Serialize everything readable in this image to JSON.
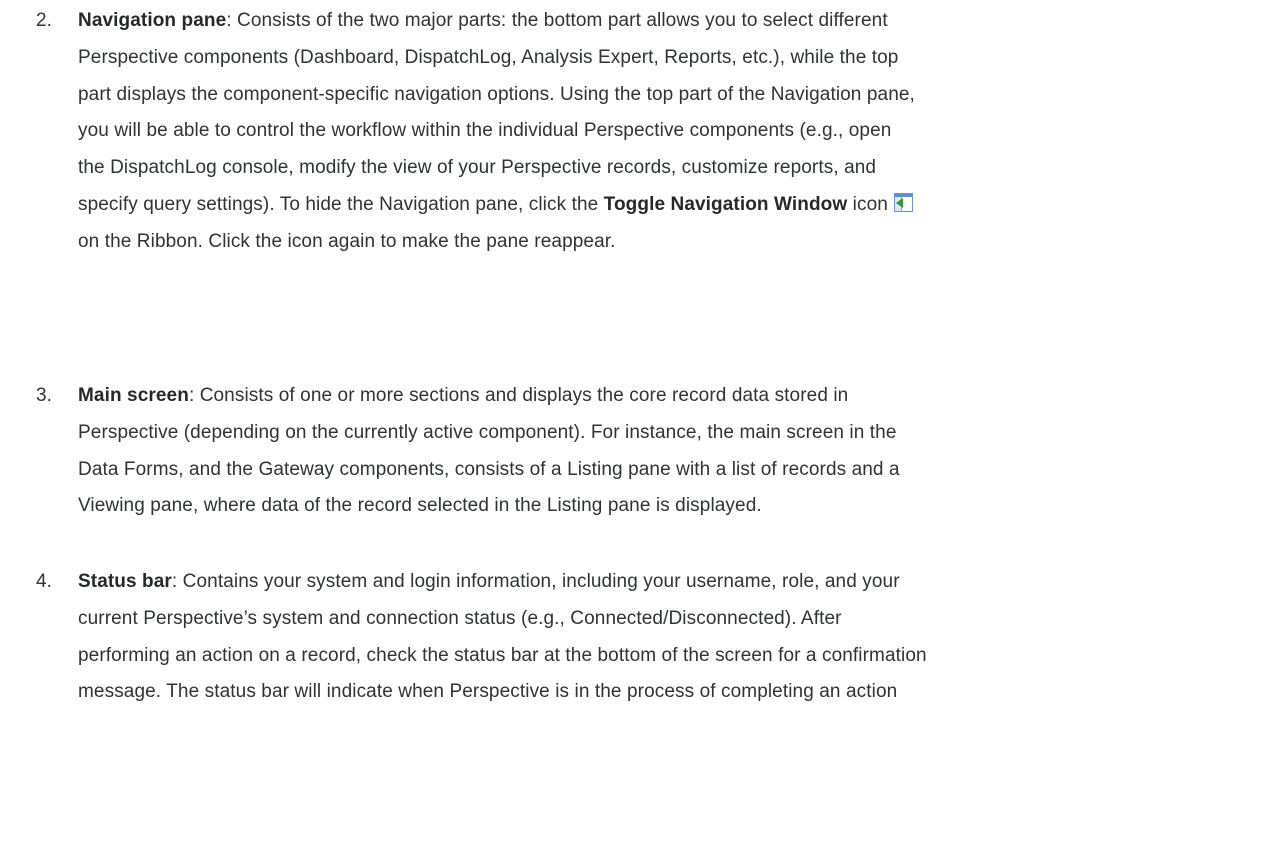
{
  "items": [
    {
      "number": "2.",
      "term": "Navigation pane",
      "lines": [
        ": Consists of the two major parts: the bottom part allows you to select different",
        "Perspective components (Dashboard, DispatchLog, Analysis Expert, Reports, etc.), while the top",
        "part displays the component-specific navigation options. Using the top part of the Navigation pane,",
        "you will be able to control the workflow within the individual Perspective components (e.g., open",
        "the DispatchLog console, modify the view of your Perspective records, customize reports, and"
      ],
      "line6_prefix": "specify query settings). To hide the Navigation pane, click the ",
      "line6_bold": "Toggle Navigation Window",
      "line6_suffix": " icon",
      "line7": "on the Ribbon. Click the icon again to make the pane reappear."
    },
    {
      "number": "3.",
      "term": "Main screen",
      "lines": [
        ": Consists of one or more sections and displays the core record data stored in",
        "Perspective (depending on the currently active component). For instance, the main screen in the",
        "Data Forms, and the Gateway components, consists of a Listing pane with a list of records and a",
        "Viewing pane, where data of the record selected in the Listing pane is displayed."
      ]
    },
    {
      "number": "4.",
      "term": "Status bar",
      "lines": [
        ": Contains your system and login information, including your username, role, and your",
        "current Perspective’s system and connection status (e.g., Connected/Disconnected). After",
        "performing an action on a record, check the status bar at the bottom of the screen for a confirmation",
        "message. The status bar will indicate when Perspective is in the process of completing an action"
      ]
    }
  ],
  "icon": {
    "name": "toggle-navigation-window-icon",
    "arrow_color": "#2e9a2e",
    "frame_color": "#5b8fd0"
  }
}
